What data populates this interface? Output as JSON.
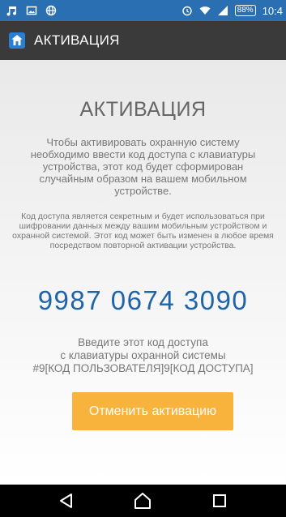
{
  "status_bar": {
    "battery": "88%",
    "time": "10:4",
    "icons": [
      "music-note-icon",
      "image-icon",
      "globe-icon",
      "alarm-icon",
      "wifi-icon",
      "signal-icon",
      "battery-icon"
    ]
  },
  "app_bar": {
    "title": "АКТИВАЦИЯ",
    "logo_icon": "house-shield-icon"
  },
  "main": {
    "heading": "АКТИВАЦИЯ",
    "paragraph1": "Чтобы активировать охранную систему необходимо ввести код доступа с клавиатуры устройства, этот код будет сформирован случайным образом на вашем мобильном устройстве.",
    "paragraph2": "Код доступа является секретным и будет использоваться при шифровании данных между вашим мобильным устройством и охранной системой. Этот код может быть изменен в любое время посредством повторной активации устройства.",
    "access_code": "9987 0674 3090",
    "instruction_line1": "Введите этот код доступа",
    "instruction_line2": "с клавиатуры охранной системы",
    "instruction_line3": "#9[КОД ПОЛЬЗОВАТЕЛЯ]9[КОД ДОСТУПА]",
    "cancel_button": "Отменить активацию"
  },
  "nav_bar": {
    "icons": [
      "back-icon",
      "home-icon",
      "recents-icon"
    ]
  },
  "colors": {
    "status_bar": "#2a6fb1",
    "app_bar": "#3a3a3a",
    "code": "#1f63a8",
    "button": "#f7b33c"
  }
}
